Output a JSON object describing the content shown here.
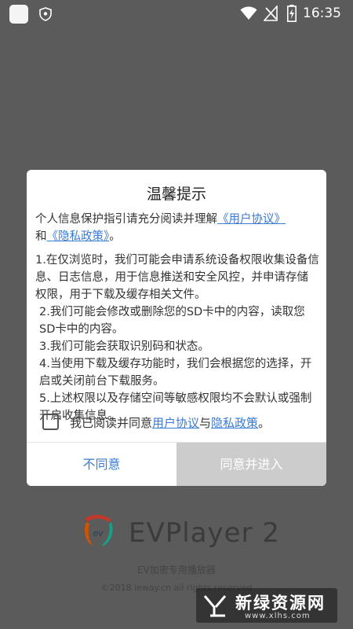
{
  "status_bar": {
    "time": "16:35",
    "icons": [
      "app-icon",
      "shield-icon",
      "wifi-icon",
      "no-signal-icon",
      "battery-charging-icon"
    ]
  },
  "background": {
    "app_name": "EVPlayer 2",
    "tagline": "EV加密专用播放器",
    "copyright": "©2018 ieway.cn all rights reserved"
  },
  "dialog": {
    "title": "温馨提示",
    "intro_prefix": "个人信息保护指引请充分阅读并理解",
    "intro_link_user": "《用户协议》",
    "intro_and": "和",
    "intro_link_privacy": "《隐私政策》",
    "intro_suffix": "。",
    "items": [
      "1.在仅浏览时，我们可能会申请系统设备权限收集设备信息、日志信息，用于信息推送和安全风控，并申请存储权限，用于下载及缓存相关文件。",
      "2.我们可能会修改或删除您的SD卡中的内容，读取您SD卡中的内容。",
      "3.我们可能会获取识别码和状态。",
      "4.当使用下载及缓存功能时，我们会根据您的选择，开启或关闭前台下载服务。",
      "5.上述权限以及存储空间等敏感权限均不会默认或强制开启收集信息。"
    ],
    "agree_prefix": "我已阅读并同意",
    "agree_link_user": "用户协议",
    "agree_and": "与",
    "agree_link_privacy": "隐私政策",
    "agree_suffix": "。",
    "agree_checked": false,
    "decline_label": "不同意",
    "accept_label": "同意并进入"
  },
  "watermark": {
    "title": "新绿资源网",
    "url": "www.xlhs.com"
  },
  "colors": {
    "link": "#3a7bd5",
    "overlay": "#5b5b5b",
    "accept_disabled": "#cccccc"
  }
}
